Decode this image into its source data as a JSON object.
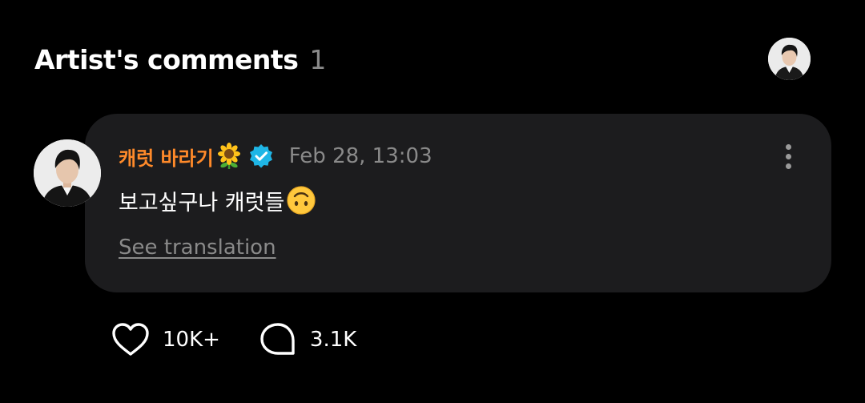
{
  "header": {
    "title": "Artist's comments",
    "count": "1",
    "avatar_icon": "artist-avatar"
  },
  "comment": {
    "author": "캐럿 바라기",
    "author_color": "#ff8a2a",
    "name_emoji": "sunflower-icon",
    "verified_icon": "verified-badge-icon",
    "verified_color": "#1fb6e6",
    "timestamp": "Feb 28, 13:03",
    "text": "보고싶구나 캐럿들",
    "text_emoji": "upside-down-face-icon",
    "see_translation": "See translation",
    "more_icon": "more-vertical-icon"
  },
  "actions": {
    "like_icon": "heart-icon",
    "like_count": "10K+",
    "reply_icon": "comment-bubble-icon",
    "reply_count": "3.1K"
  },
  "colors": {
    "background": "#000000",
    "card": "#1c1c1e",
    "muted_text": "#8a8a8a"
  }
}
